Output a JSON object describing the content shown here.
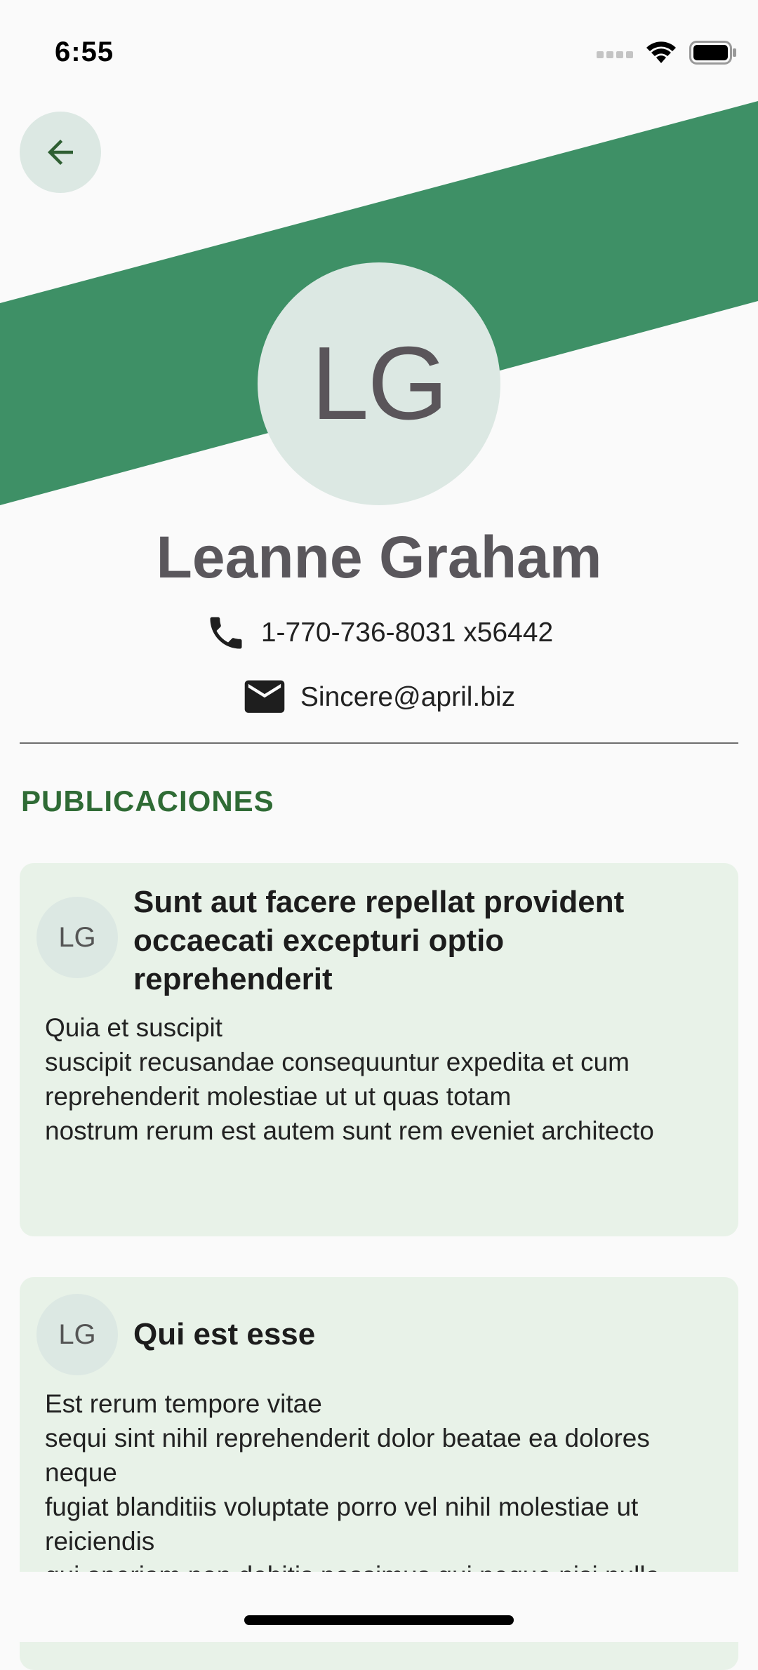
{
  "status_bar": {
    "time": "6:55"
  },
  "colors": {
    "banner": "#3e9066",
    "avatar_bg": "#dce8e3",
    "accent": "#2f6b35",
    "card_bg": "#e8f2e8"
  },
  "profile": {
    "initials": "LG",
    "name": "Leanne Graham",
    "phone": "1-770-736-8031 x56442",
    "email": "Sincere@april.biz"
  },
  "section": {
    "title": "PUBLICACIONES"
  },
  "posts": [
    {
      "initials": "LG",
      "title": "Sunt aut facere repellat provident occaecati excepturi optio reprehenderit",
      "body": "Quia et suscipit\nsuscipit recusandae consequuntur expedita et cum\nreprehenderit molestiae ut ut quas totam\nnostrum rerum est autem sunt rem eveniet architecto"
    },
    {
      "initials": "LG",
      "title": "Qui est esse",
      "body": "Est rerum tempore vitae\nsequi sint nihil reprehenderit dolor beatae ea dolores neque\nfugiat blanditiis voluptate porro vel nihil molestiae ut reiciendis\nqui aperiam non debitis possimus qui neque nisi nulla"
    }
  ],
  "icons": {
    "back": "arrow-back-icon",
    "phone": "phone-icon",
    "email": "email-icon",
    "signal": "signal-icon",
    "wifi": "wifi-icon",
    "battery": "battery-icon"
  }
}
